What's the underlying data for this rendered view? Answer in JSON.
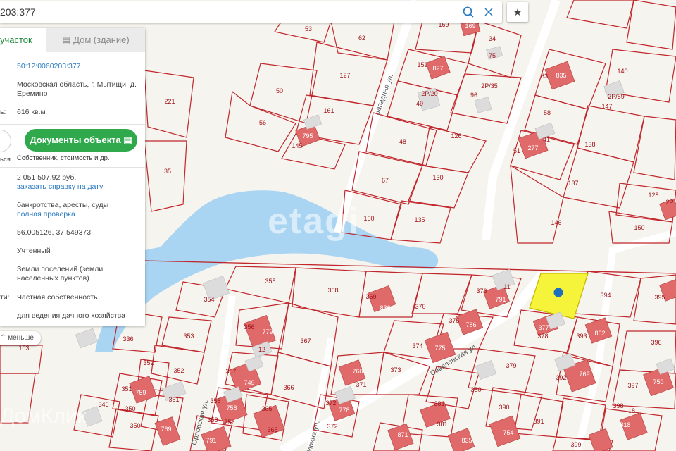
{
  "search": {
    "value": "203:377"
  },
  "map": {
    "streets": [
      "Западная ул.",
      "Савеловская ул.",
      "Орловская ул.",
      "Ирина ул."
    ],
    "plots": [
      "53",
      "62",
      "169",
      "34",
      "75",
      "159",
      "2Р/20",
      "127",
      "2Р/35",
      "96",
      "63",
      "140",
      "2Р/59",
      "147",
      "50",
      "49",
      "161",
      "145",
      "48",
      "126",
      "58",
      "221",
      "138",
      "51",
      "41",
      "35",
      "67",
      "130",
      "137",
      "128",
      "2Р",
      "160",
      "135",
      "146",
      "150",
      "355",
      "368",
      "369",
      "836",
      "370",
      "376",
      "11",
      "791",
      "394",
      "395",
      "354",
      "375",
      "786",
      "336",
      "356",
      "779",
      "367",
      "374",
      "775",
      "378",
      "393",
      "392",
      "353",
      "373",
      "379",
      "352",
      "357",
      "749",
      "371",
      "380",
      "366",
      "390",
      "397",
      "351",
      "739",
      "358",
      "756",
      "372",
      "381",
      "398",
      "346",
      "350",
      "765",
      "365",
      "391",
      "399",
      "103",
      "760",
      "778",
      "862",
      "769",
      "748",
      "12",
      "377",
      "351",
      "381",
      "396"
    ],
    "selected_plot": "377"
  },
  "panel": {
    "tab_plot": "участок",
    "tab_house": "Дом (здание)",
    "cadastral_number": "50:12:0060203:377",
    "address": "Московская область, г. Мытищи, д. Еремино",
    "area_label": "ь:",
    "area": "616 кв.м",
    "docs_button": "Документы объекта",
    "docs_sub": "Собственник, стоимость и др.",
    "side_label": "ься",
    "cost": "2 051 507.92 руб.",
    "order_link": "заказать справку на дату",
    "checks": "банкротства, аресты, суды",
    "full_check_link": "полная проверка",
    "coordinates": "56.005126, 37.549373",
    "status": "Учтенный",
    "category": "Земли поселений (земли населенных пунктов)",
    "ownership_label": "ти:",
    "ownership": "Частная собственность",
    "usage": "для ведения дачного хозяйства",
    "less_button": "меньше"
  },
  "watermarks": {
    "etagi": "etagi",
    "domclick": "ДомКлик"
  },
  "colors": {
    "selected": "#f5f33a",
    "pin": "#1f6fc1",
    "plot_line": "#c0262c",
    "water": "#a9d4f2",
    "green_button": "#2fa94c"
  }
}
